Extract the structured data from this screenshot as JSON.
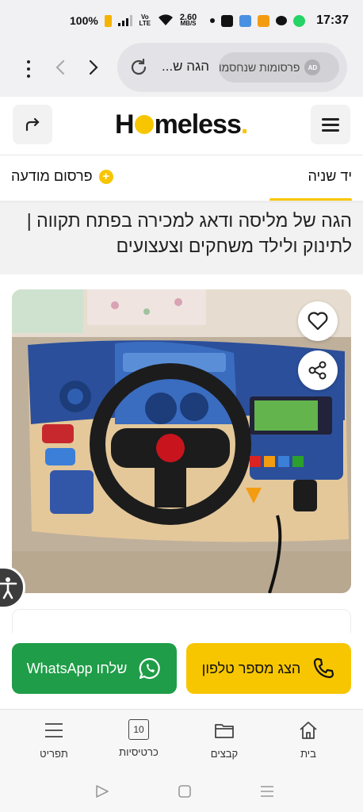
{
  "status_bar": {
    "time": "17:37",
    "battery": "100%",
    "network": "Vo LTE",
    "speed_value": "2.60",
    "speed_unit": "MB/S"
  },
  "browser": {
    "url_text": "הגה ש...",
    "ad_chip_label": "פרסומות שנחסמו",
    "ad_badge": "AD"
  },
  "site": {
    "logo_start": "H",
    "logo_mid": "meless",
    "logo_dot": "."
  },
  "tabs": {
    "second_hand": "יד שניה",
    "post_ad": "פרסום מודעה",
    "plus": "+"
  },
  "listing": {
    "title": "הגה של מליסה ודאג למכירה בפתח תקווה | לתינוק ולילד משחקים וצעצועים"
  },
  "cta": {
    "phone_label": "הצג מספר טלפון",
    "whatsapp_label": "שלחו WhatsApp"
  },
  "bottom_nav": {
    "home": "בית",
    "folders": "קבצים",
    "cards": "כרטיסיות",
    "cards_count": "10",
    "menu": "תפריט"
  },
  "colors": {
    "brand_yellow": "#f7c600",
    "whatsapp_green": "#1f9d48"
  }
}
